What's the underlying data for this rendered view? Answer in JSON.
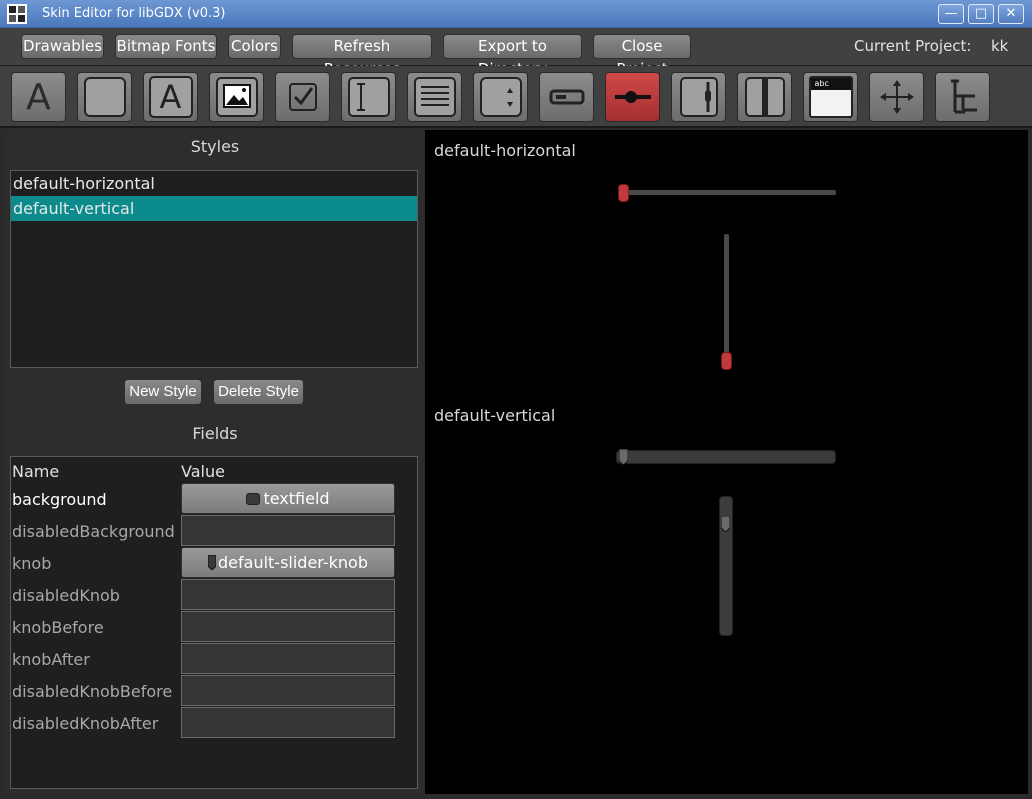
{
  "window": {
    "title": "Skin Editor for libGDX (v0.3)",
    "controls": {
      "minimize": "—",
      "maximize": "□",
      "close": "✕"
    }
  },
  "menu": {
    "drawables": "Drawables",
    "bitmap_fonts": "Bitmap Fonts",
    "colors": "Colors",
    "refresh": "Refresh Resources",
    "export": "Export to Directory",
    "close_project": "Close Project",
    "current_project_label": "Current Project:",
    "current_project_value": "kk"
  },
  "toolbar": {
    "tools": [
      "label-icon",
      "button-icon",
      "text-button-icon",
      "image-button-icon",
      "checkbox-icon",
      "textfield-icon",
      "list-icon",
      "select-box-icon",
      "progress-bar-icon",
      "slider-icon",
      "scroll-pane-icon",
      "split-pane-icon",
      "window-icon",
      "touchpad-icon",
      "tree-icon"
    ],
    "label_glyph": "A",
    "text_button_glyph": "A",
    "window_glyph": "abc",
    "active_tool": "slider-icon",
    "active_color": "#c0393b"
  },
  "styles": {
    "title": "Styles",
    "items": [
      {
        "label": "default-horizontal",
        "selected": false
      },
      {
        "label": "default-vertical",
        "selected": true
      }
    ],
    "new_style": "New Style",
    "delete_style": "Delete Style",
    "selection_color": "#0b8b8b"
  },
  "fields": {
    "title": "Fields",
    "col_name": "Name",
    "col_value": "Value",
    "rows": [
      {
        "name": "background",
        "value": "textfield",
        "set": true
      },
      {
        "name": "disabledBackground",
        "value": "",
        "set": false
      },
      {
        "name": "knob",
        "value": "default-slider-knob",
        "set": false
      },
      {
        "name": "disabledKnob",
        "value": "",
        "set": false
      },
      {
        "name": "knobBefore",
        "value": "",
        "set": false
      },
      {
        "name": "knobAfter",
        "value": "",
        "set": false
      },
      {
        "name": "disabledKnobBefore",
        "value": "",
        "set": false
      },
      {
        "name": "disabledKnobAfter",
        "value": "",
        "set": false
      }
    ]
  },
  "preview": {
    "horizontal_label": "default-horizontal",
    "vertical_label": "default-vertical",
    "knob_color": "#c0393b"
  }
}
